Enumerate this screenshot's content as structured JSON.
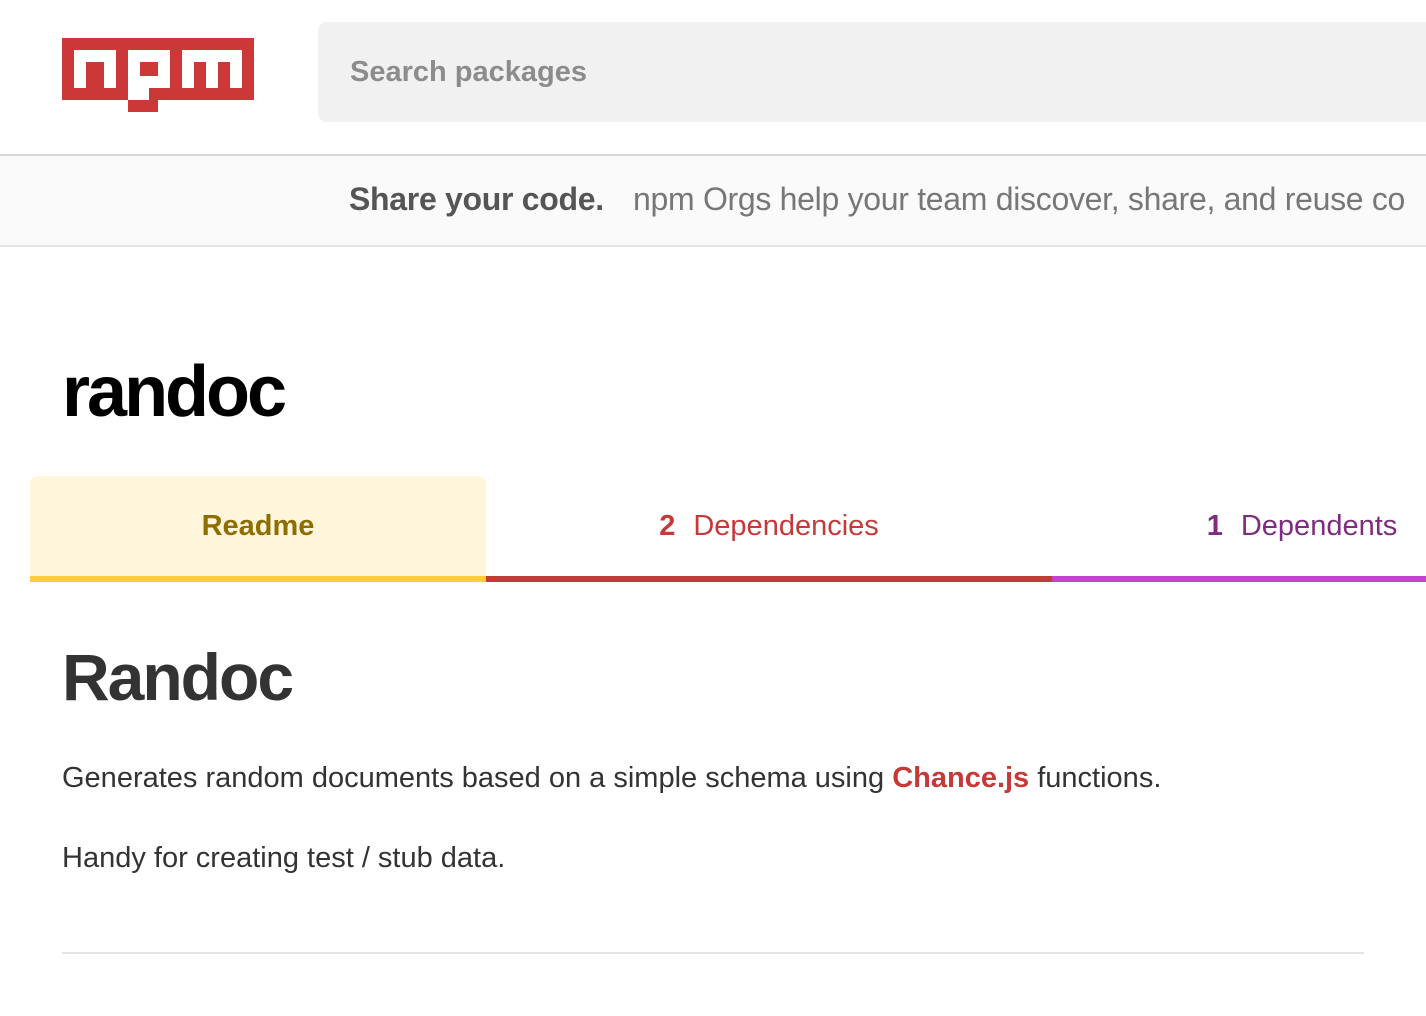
{
  "header": {
    "logo_text": "npm",
    "logo_color": "#cb3837",
    "search": {
      "placeholder": "Search packages",
      "value": "",
      "icon": "search-icon"
    }
  },
  "promo": {
    "title": "Share your code.",
    "text": "npm Orgs help your team discover, share, and reuse co"
  },
  "package": {
    "name": "randoc"
  },
  "tabs": [
    {
      "label": "Readme",
      "count": "",
      "active": true,
      "color": "#ffcd3c"
    },
    {
      "label": "Dependencies",
      "count": "2",
      "active": false,
      "color": "#c23b3b"
    },
    {
      "label": "Dependents",
      "count": "1",
      "active": false,
      "color": "#c842c8"
    }
  ],
  "readme": {
    "heading": "Randoc",
    "paragraph1": {
      "before": "Generates random documents based on a simple schema using ",
      "link_text": "Chance.js",
      "after": " functions."
    },
    "paragraph2": "Handy for creating test / stub data."
  }
}
